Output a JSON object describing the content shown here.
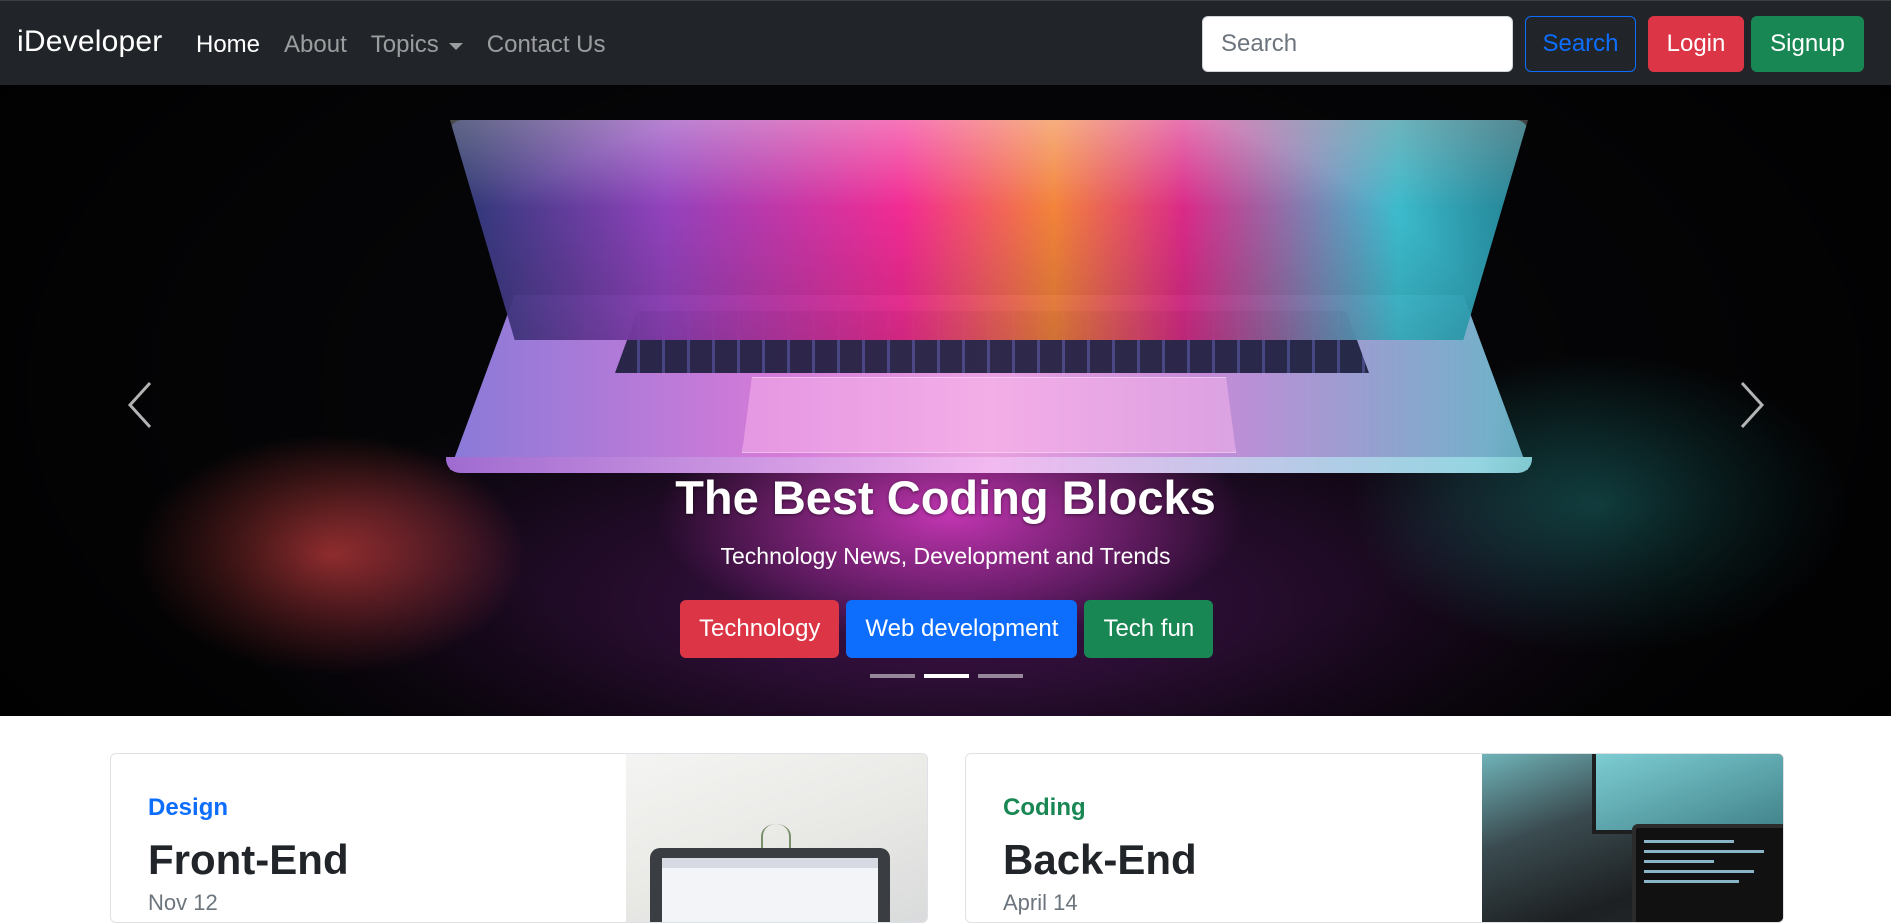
{
  "navbar": {
    "brand": "iDeveloper",
    "links": [
      {
        "label": "Home",
        "active": true
      },
      {
        "label": "About",
        "active": false
      },
      {
        "label": "Topics",
        "active": false,
        "dropdown": true
      },
      {
        "label": "Contact Us",
        "active": false
      }
    ],
    "search": {
      "placeholder": "Search",
      "value": ""
    },
    "search_button": "Search",
    "login_button": "Login",
    "signup_button": "Signup"
  },
  "hero": {
    "title": "The Best Coding Blocks",
    "subtitle": "Technology News, Development and Trends",
    "buttons": [
      "Technology",
      "Web development",
      "Tech fun"
    ],
    "slide_count": 3,
    "active_slide": 2
  },
  "cards": [
    {
      "category": "Design",
      "title": "Front-End",
      "date": "Nov 12"
    },
    {
      "category": "Coding",
      "title": "Back-End",
      "date": "April 14"
    }
  ],
  "colors": {
    "navbar_bg": "#212529",
    "primary": "#0d6efd",
    "danger": "#dc3545",
    "success": "#198754"
  }
}
